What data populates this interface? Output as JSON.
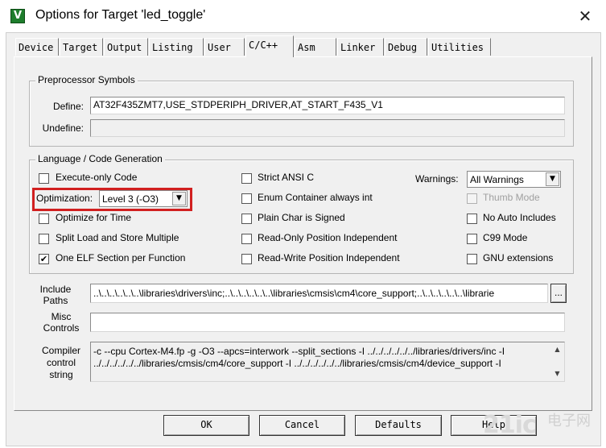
{
  "window": {
    "title": "Options for Target 'led_toggle'",
    "app_icon_glyph": "V",
    "close_glyph": "✕"
  },
  "tabs": [
    {
      "label": "Device"
    },
    {
      "label": "Target"
    },
    {
      "label": "Output"
    },
    {
      "label": "Listing"
    },
    {
      "label": "User"
    },
    {
      "label": "C/C++",
      "active": true
    },
    {
      "label": "Asm"
    },
    {
      "label": "Linker"
    },
    {
      "label": "Debug"
    },
    {
      "label": "Utilities"
    }
  ],
  "preprocessor": {
    "title": "Preprocessor Symbols",
    "define_label": "Define:",
    "define_value": "AT32F435ZMT7,USE_STDPERIPH_DRIVER,AT_START_F435_V1",
    "undefine_label": "Undefine:",
    "undefine_value": ""
  },
  "language": {
    "title": "Language / Code Generation",
    "execute_only": {
      "label": "Execute-only Code",
      "checked": false
    },
    "optimization_label": "Optimization:",
    "optimization_value": "Level 3 (-O3)",
    "optimize_time": {
      "label": "Optimize for Time",
      "checked": false
    },
    "split_load": {
      "label": "Split Load and Store Multiple",
      "checked": false
    },
    "one_elf": {
      "label": "One ELF Section per Function",
      "checked": true
    },
    "strict_ansi": {
      "label": "Strict ANSI C",
      "checked": false
    },
    "enum_container": {
      "label": "Enum Container always int",
      "checked": false
    },
    "plain_char": {
      "label": "Plain Char is Signed",
      "checked": false
    },
    "ro_pi": {
      "label": "Read-Only Position Independent",
      "checked": false
    },
    "rw_pi": {
      "label": "Read-Write Position Independent",
      "checked": false
    },
    "warnings_label": "Warnings:",
    "warnings_value": "All Warnings",
    "thumb_mode": {
      "label": "Thumb Mode",
      "checked": false,
      "disabled": true
    },
    "no_auto_includes": {
      "label": "No Auto Includes",
      "checked": false
    },
    "c99_mode": {
      "label": "C99 Mode",
      "checked": false
    },
    "gnu_ext": {
      "label": "GNU extensions",
      "checked": false
    }
  },
  "include": {
    "label_line1": "Include",
    "label_line2": "Paths",
    "value": "..\\..\\..\\..\\..\\..\\libraries\\drivers\\inc;..\\..\\..\\..\\..\\..\\libraries\\cmsis\\cm4\\core_support;..\\..\\..\\..\\..\\..\\librarie",
    "browse": "..."
  },
  "misc": {
    "label_line1": "Misc",
    "label_line2": "Controls",
    "value": ""
  },
  "compiler": {
    "label_line1": "Compiler",
    "label_line2": "control",
    "label_line3": "string",
    "line1": "-c --cpu Cortex-M4.fp -g -O3 --apcs=interwork --split_sections -I ../../../../../../libraries/drivers/inc -I",
    "line2": "../../../../../../libraries/cmsis/cm4/core_support -I ../../../../../../libraries/cmsis/cm4/device_support -I"
  },
  "buttons": {
    "ok": "OK",
    "cancel": "Cancel",
    "defaults": "Defaults",
    "help": "Help"
  },
  "watermark": {
    "text": "21ic",
    "sub": "电子网"
  },
  "colors": {
    "highlight": "#d12020",
    "icon_bg": "#1e7d2c"
  }
}
